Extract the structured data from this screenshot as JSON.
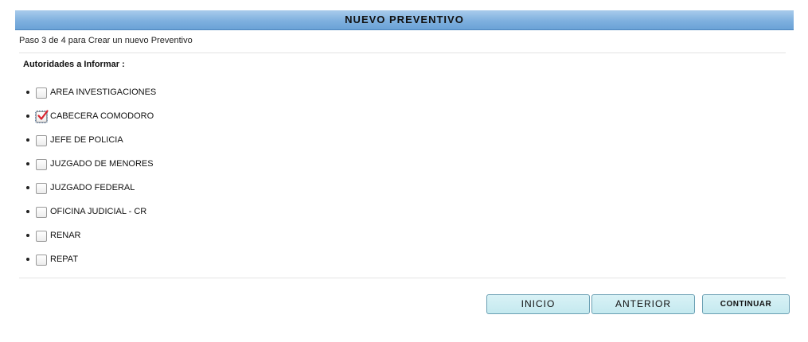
{
  "header": {
    "title": "NUEVO PREVENTIVO"
  },
  "step": {
    "text": "Paso 3 de 4 para Crear un nuevo Preventivo"
  },
  "authorities": {
    "label": "Autoridades a Informar :",
    "items": [
      {
        "label": "AREA INVESTIGACIONES",
        "checked": false
      },
      {
        "label": "CABECERA COMODORO",
        "checked": true
      },
      {
        "label": "JEFE DE POLICIA",
        "checked": false
      },
      {
        "label": "JUZGADO DE MENORES",
        "checked": false
      },
      {
        "label": "JUZGADO FEDERAL",
        "checked": false
      },
      {
        "label": "OFICINA JUDICIAL - CR",
        "checked": false
      },
      {
        "label": "RENAR",
        "checked": false
      },
      {
        "label": "REPAT",
        "checked": false
      }
    ]
  },
  "buttons": {
    "inicio": "INICIO",
    "anterior": "ANTERIOR",
    "continuar": "CONTINUAR"
  },
  "colors": {
    "header_bar": "#7fb0df",
    "button_bg": "#c4e9ef",
    "check_mark": "#d9232f"
  },
  "icons": {
    "check": "check-mark-icon",
    "bullet": "bullet-icon"
  }
}
